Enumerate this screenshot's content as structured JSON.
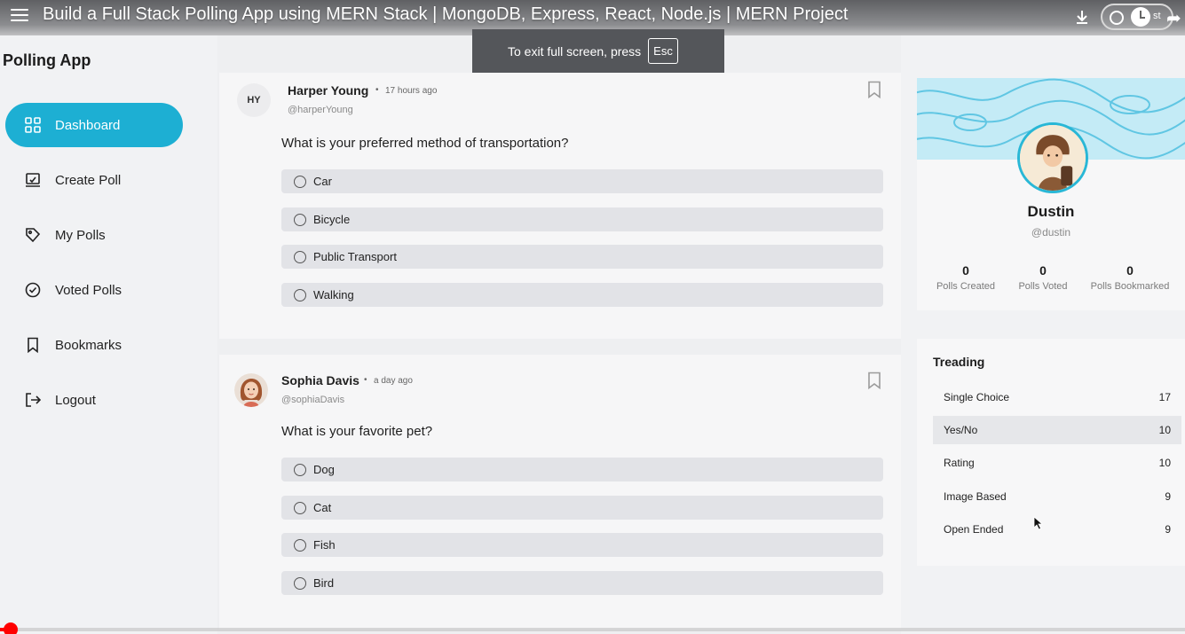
{
  "youtube": {
    "video_title": "Build a Full Stack Polling App using MERN Stack | MongoDB, Express, React, Node.js | MERN Project",
    "fullscreen_toast": "To exit full screen, press",
    "esc_key": "Esc",
    "pill_text": "st",
    "progress_fraction": 0.008,
    "accent_color": "#ff0000"
  },
  "app": {
    "name": "Polling App"
  },
  "sidebar": {
    "items": [
      {
        "label": "Dashboard",
        "icon": "dashboard-icon",
        "active": true
      },
      {
        "label": "Create Poll",
        "icon": "create-poll-icon"
      },
      {
        "label": "My Polls",
        "icon": "my-polls-icon"
      },
      {
        "label": "Voted Polls",
        "icon": "voted-polls-icon"
      },
      {
        "label": "Bookmarks",
        "icon": "bookmark-icon"
      },
      {
        "label": "Logout",
        "icon": "logout-icon"
      }
    ],
    "accent_color": "#1dafd3"
  },
  "polls": [
    {
      "initials": "HY",
      "name": "Harper Young",
      "time": "17 hours ago",
      "handle": "@harperYoung",
      "question": "What is your preferred method of transportation?",
      "options": [
        "Car",
        "Bicycle",
        "Public Transport",
        "Walking"
      ]
    },
    {
      "name": "Sophia Davis",
      "time": "a day ago",
      "handle": "@sophiaDavis",
      "question": "What is your favorite pet?",
      "options": [
        "Dog",
        "Cat",
        "Fish",
        "Bird"
      ]
    }
  ],
  "profile": {
    "name": "Dustin",
    "handle": "@dustin",
    "stats": [
      {
        "value": "0",
        "label": "Polls Created"
      },
      {
        "value": "0",
        "label": "Polls Voted"
      },
      {
        "value": "0",
        "label": "Polls Bookmarked"
      }
    ]
  },
  "trending": {
    "title": "Treading",
    "items": [
      {
        "label": "Single Choice",
        "count": "17"
      },
      {
        "label": "Yes/No",
        "count": "10"
      },
      {
        "label": "Rating",
        "count": "10"
      },
      {
        "label": "Image Based",
        "count": "9"
      },
      {
        "label": "Open Ended",
        "count": "9"
      }
    ]
  }
}
